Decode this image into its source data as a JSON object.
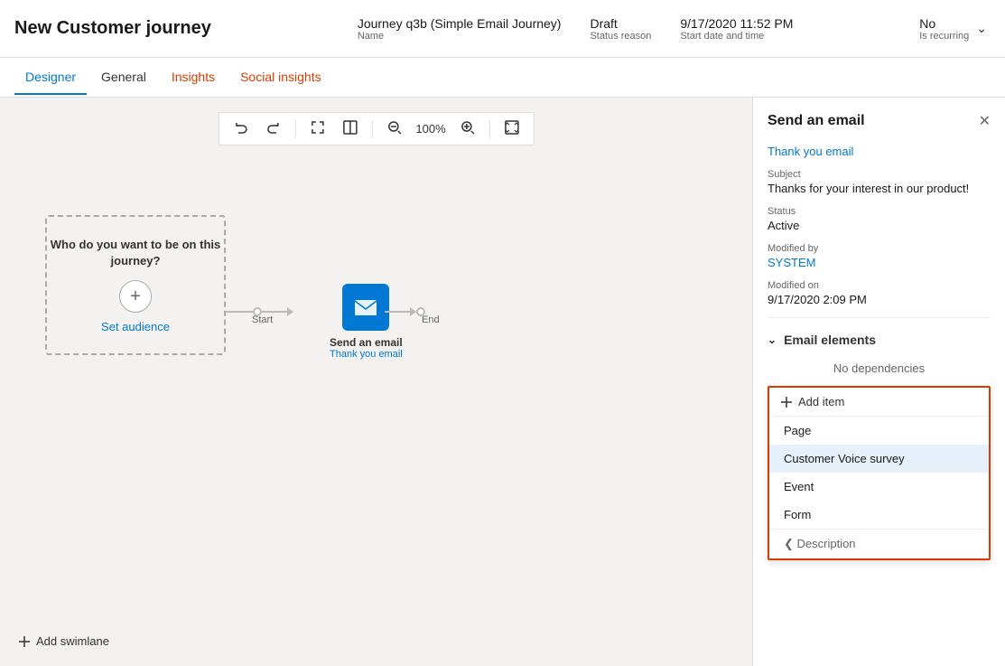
{
  "header": {
    "title": "New Customer journey",
    "meta": {
      "name_value": "Journey q3b (Simple Email Journey)",
      "name_label": "Name",
      "status_value": "Draft",
      "status_label": "Status reason",
      "date_value": "9/17/2020 11:52 PM",
      "date_label": "Start date and time",
      "recurring_value": "No",
      "recurring_label": "Is recurring"
    }
  },
  "tabs": [
    {
      "id": "designer",
      "label": "Designer",
      "active": true
    },
    {
      "id": "general",
      "label": "General",
      "active": false
    },
    {
      "id": "insights",
      "label": "Insights",
      "active": false,
      "color": "orange"
    },
    {
      "id": "social-insights",
      "label": "Social insights",
      "active": false,
      "color": "orange"
    }
  ],
  "toolbar": {
    "undo": "↩",
    "redo": "↪",
    "zoom_in_label": "⊕",
    "zoom_out_label": "⊖",
    "zoom_value": "100%",
    "fit_label": "⛶",
    "split_label": "⊞"
  },
  "canvas": {
    "audience_text": "Who do you want to be on this journey?",
    "set_audience_label": "Set audience",
    "add_swimlane_label": "Add swimlane",
    "start_label": "Start",
    "end_label": "End",
    "node_label": "Send an email",
    "node_sublabel": "Thank you email"
  },
  "right_panel": {
    "title": "Send an email",
    "email_link": "Thank you email",
    "subject_label": "Subject",
    "subject_value": "Thanks for your interest in our product!",
    "status_label": "Status",
    "status_value": "Active",
    "modified_by_label": "Modified by",
    "modified_by_value": "SYSTEM",
    "modified_on_label": "Modified on",
    "modified_on_value": "9/17/2020 2:09 PM",
    "email_elements_label": "Email elements",
    "no_deps_label": "No dependencies",
    "add_item_label": "Add item",
    "menu_items": [
      {
        "id": "page",
        "label": "Page",
        "selected": false
      },
      {
        "id": "customer-voice-survey",
        "label": "Customer Voice survey",
        "selected": true
      },
      {
        "id": "event",
        "label": "Event",
        "selected": false
      },
      {
        "id": "form",
        "label": "Form",
        "selected": false
      },
      {
        "id": "description",
        "label": "Description",
        "selected": false
      }
    ]
  }
}
